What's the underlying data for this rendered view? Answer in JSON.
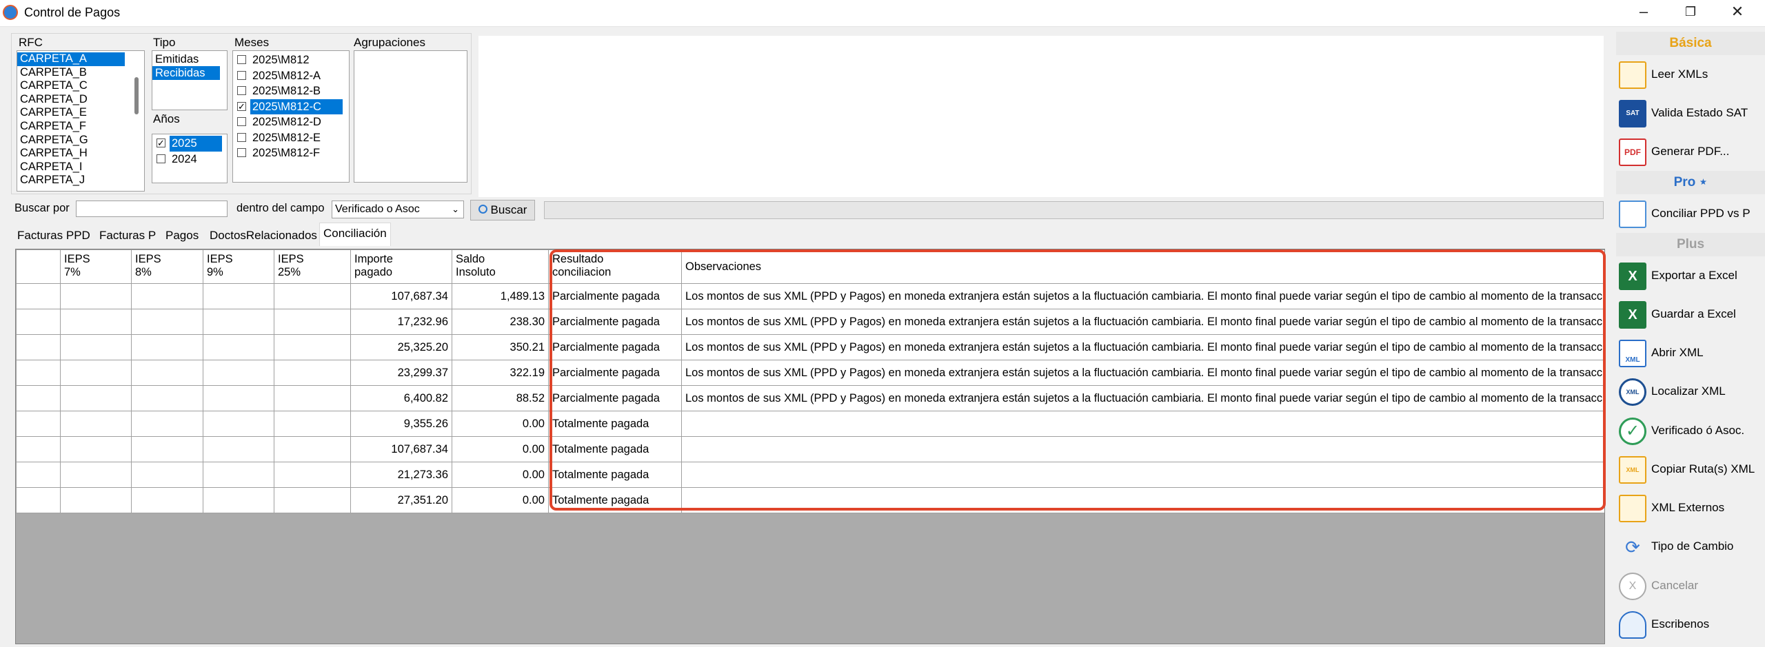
{
  "window": {
    "title": "Control de Pagos",
    "minimize_icon": "–",
    "restore_icon": "❐",
    "close_icon": "✕"
  },
  "filters": {
    "rfc": {
      "label": "RFC",
      "items": [
        "CARPETA_A",
        "CARPETA_B",
        "CARPETA_C",
        "CARPETA_D",
        "CARPETA_E",
        "CARPETA_F",
        "CARPETA_G",
        "CARPETA_H",
        "CARPETA_I",
        "CARPETA_J"
      ],
      "selected": "CARPETA_A"
    },
    "tipo": {
      "label": "Tipo",
      "items": [
        "Emitidas",
        "Recibidas"
      ],
      "selected": "Recibidas"
    },
    "anios": {
      "label": "Años",
      "items": [
        {
          "label": "2025",
          "checked": true,
          "selected": true
        },
        {
          "label": "2024",
          "checked": false,
          "selected": false
        }
      ]
    },
    "meses": {
      "label": "Meses",
      "items": [
        {
          "label": "2025\\M812",
          "checked": false,
          "selected": false
        },
        {
          "label": "2025\\M812-A",
          "checked": false,
          "selected": false
        },
        {
          "label": "2025\\M812-B",
          "checked": false,
          "selected": false
        },
        {
          "label": "2025\\M812-C",
          "checked": true,
          "selected": true
        },
        {
          "label": "2025\\M812-D",
          "checked": false,
          "selected": false
        },
        {
          "label": "2025\\M812-E",
          "checked": false,
          "selected": false
        },
        {
          "label": "2025\\M812-F",
          "checked": false,
          "selected": false
        }
      ]
    },
    "agrupaciones": {
      "label": "Agrupaciones"
    }
  },
  "search": {
    "buscar_por_label": "Buscar por",
    "buscar_value": "",
    "dentro_label": "dentro del campo",
    "campo_selected": "Verificado o Asoc",
    "buscar_button": "Buscar"
  },
  "tabs": [
    {
      "label": "Facturas PPD",
      "active": false
    },
    {
      "label": "Facturas P",
      "active": false
    },
    {
      "label": "Pagos",
      "active": false
    },
    {
      "label": "DoctosRelacionados",
      "active": false
    },
    {
      "label": "Conciliación",
      "active": true
    }
  ],
  "grid": {
    "columns": [
      {
        "key": "sel",
        "line1": "",
        "line2": ""
      },
      {
        "key": "ieps7",
        "line1": "IEPS",
        "line2": "7%"
      },
      {
        "key": "ieps8",
        "line1": "IEPS",
        "line2": "8%"
      },
      {
        "key": "ieps9",
        "line1": "IEPS",
        "line2": "9%"
      },
      {
        "key": "ieps25",
        "line1": "IEPS",
        "line2": "25%"
      },
      {
        "key": "importe",
        "line1": "Importe",
        "line2": "pagado"
      },
      {
        "key": "saldo",
        "line1": "Saldo",
        "line2": "Insoluto"
      },
      {
        "key": "resultado",
        "line1": "Resultado",
        "line2": "conciliacion"
      },
      {
        "key": "obs",
        "line1": "Observaciones",
        "line2": ""
      }
    ],
    "rows": [
      {
        "importe": "107,687.34",
        "saldo": "1,489.13",
        "resultado": "Parcialmente pagada",
        "obs": "Los montos de sus XML (PPD y Pagos) en moneda extranjera están sujetos a la fluctuación cambiaria. El monto final puede variar según el tipo de cambio al momento de la transacción"
      },
      {
        "importe": "17,232.96",
        "saldo": "238.30",
        "resultado": "Parcialmente pagada",
        "obs": "Los montos de sus XML (PPD y Pagos) en moneda extranjera están sujetos a la fluctuación cambiaria. El monto final puede variar según el tipo de cambio al momento de la transacción"
      },
      {
        "importe": "25,325.20",
        "saldo": "350.21",
        "resultado": "Parcialmente pagada",
        "obs": "Los montos de sus XML (PPD y Pagos) en moneda extranjera están sujetos a la fluctuación cambiaria. El monto final puede variar según el tipo de cambio al momento de la transacción"
      },
      {
        "importe": "23,299.37",
        "saldo": "322.19",
        "resultado": "Parcialmente pagada",
        "obs": "Los montos de sus XML (PPD y Pagos) en moneda extranjera están sujetos a la fluctuación cambiaria. El monto final puede variar según el tipo de cambio al momento de la transacción"
      },
      {
        "importe": "6,400.82",
        "saldo": "88.52",
        "resultado": "Parcialmente pagada",
        "obs": "Los montos de sus XML (PPD y Pagos) en moneda extranjera están sujetos a la fluctuación cambiaria. El monto final puede variar según el tipo de cambio al momento de la transacción"
      },
      {
        "importe": "9,355.26",
        "saldo": "0.00",
        "resultado": "Totalmente pagada",
        "obs": ""
      },
      {
        "importe": "107,687.34",
        "saldo": "0.00",
        "resultado": "Totalmente pagada",
        "obs": ""
      },
      {
        "importe": "21,273.36",
        "saldo": "0.00",
        "resultado": "Totalmente pagada",
        "obs": ""
      },
      {
        "importe": "27,351.20",
        "saldo": "0.00",
        "resultado": "Totalmente pagada",
        "obs": ""
      }
    ]
  },
  "sidebar": {
    "sections": {
      "basica": "Básica",
      "pro": "Pro ⋆",
      "plus": "Plus"
    },
    "section_color": "#e8a317",
    "plus_color": "#a0a0a0",
    "buttons": {
      "leer_xmls": {
        "label": "Leer XMLs",
        "icon": "folder-search-icon"
      },
      "valida_sat": {
        "label": "Valida Estado SAT",
        "icon": "sat-icon",
        "icon_text": "SAT"
      },
      "generar_pdf": {
        "label": "Generar PDF...",
        "icon": "pdf-icon",
        "icon_text": "PDF"
      },
      "conciliar": {
        "label": "Conciliar PPD vs P",
        "icon": "list-icon"
      },
      "exportar_excel": {
        "label": "Exportar a Excel",
        "icon": "excel-icon",
        "icon_text": "X"
      },
      "guardar_excel": {
        "label": "Guardar a Excel",
        "icon": "excel-save-icon",
        "icon_text": "X"
      },
      "abrir_xml": {
        "label": "Abrir XML",
        "icon": "open-xml-icon",
        "icon_text": "XML"
      },
      "localizar_xml": {
        "label": "Localizar  XML",
        "icon": "locate-xml-icon",
        "icon_text": "XML"
      },
      "verificado": {
        "label": "Verificado ó Asoc.",
        "icon": "check-icon",
        "icon_text": "✓"
      },
      "copiar_ruta": {
        "label": "Copiar Ruta(s) XML",
        "icon": "copy-path-icon",
        "icon_text": "XML"
      },
      "xml_externos": {
        "label": "XML Externos",
        "icon": "external-folder-icon"
      },
      "tipo_cambio": {
        "label": "Tipo de Cambio",
        "icon": "exchange-icon",
        "icon_text": "⟳"
      },
      "cancelar": {
        "label": "Cancelar",
        "icon": "cancel-icon",
        "icon_text": "X"
      },
      "escribenos": {
        "label": "Escribenos",
        "icon": "contact-icon"
      }
    }
  }
}
